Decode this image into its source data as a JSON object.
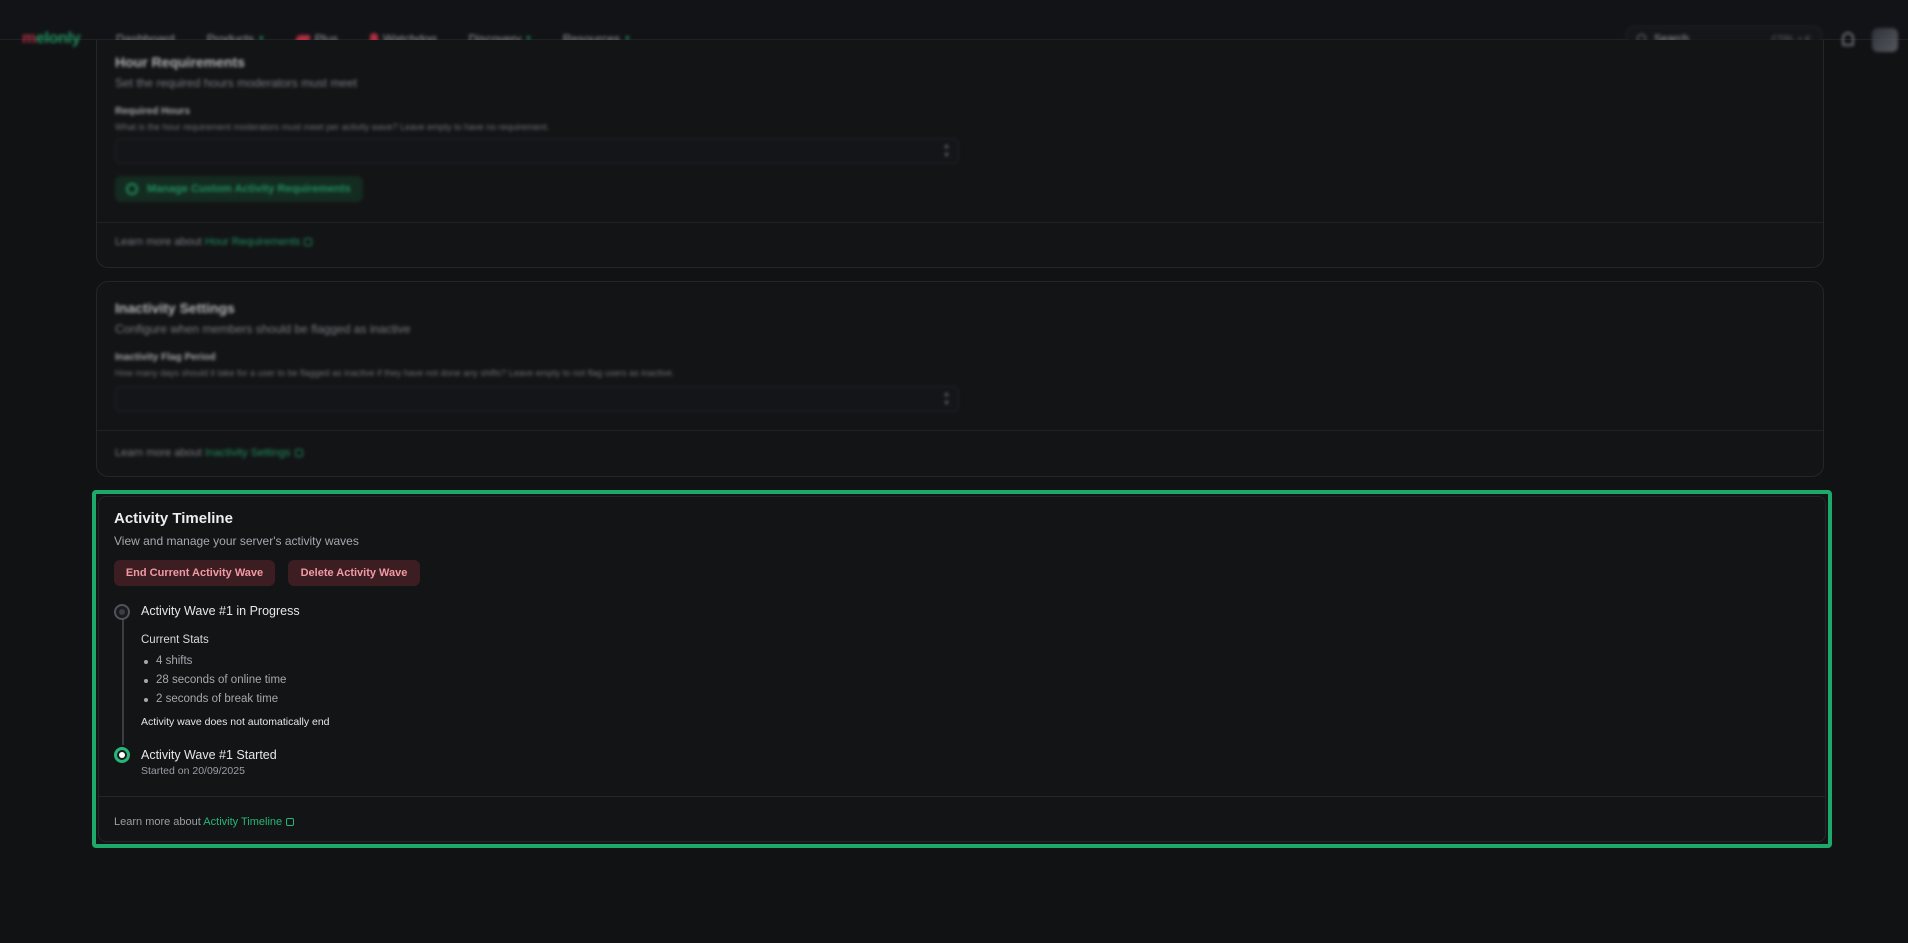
{
  "nav": {
    "logo_mark": "m",
    "logo_rest": "elonly",
    "items": [
      {
        "label": "Dashboard"
      },
      {
        "label": "Products",
        "chevron": "▾"
      },
      {
        "label": "Plus"
      },
      {
        "label": "Watchdog"
      },
      {
        "label": "Discovery",
        "chevron": "▾"
      },
      {
        "label": "Resources",
        "chevron": "▾"
      }
    ],
    "search_label": "Search",
    "search_shortcut": "CTRL + K"
  },
  "hour_requirements": {
    "title": "Hour Requirements",
    "subtitle": "Set the required hours moderators must meet",
    "field_label": "Required Hours",
    "field_help": "What is the hour requirement moderators must meet per activity wave? Leave empty to have no requirement.",
    "manage_button": "Manage Custom Activity Requirements",
    "learn_prefix": "Learn more about",
    "learn_link": "Hour Requirements"
  },
  "inactivity_settings": {
    "title": "Inactivity Settings",
    "subtitle": "Configure when members should be flagged as inactive",
    "field_label": "Inactivity Flag Period",
    "field_help": "How many days should it take for a user to be flagged as inactive if they have not done any shifts? Leave empty to not flag users as inactive.",
    "learn_prefix": "Learn more about",
    "learn_link": "Inactivity Settings"
  },
  "activity_timeline": {
    "title": "Activity Timeline",
    "subtitle": "View and manage your server's activity waves",
    "end_button": "End Current Activity Wave",
    "delete_button": "Delete Activity Wave",
    "events": [
      {
        "title": "Activity Wave #1 in Progress",
        "stats_heading": "Current Stats",
        "stats": [
          "4 shifts",
          "28 seconds of online time",
          "2 seconds of break time"
        ],
        "note": "Activity wave does not automatically end"
      },
      {
        "title": "Activity Wave #1 Started",
        "detail": "Started on 20/09/2025"
      }
    ],
    "learn_prefix": "Learn more about",
    "learn_link": "Activity Timeline"
  },
  "colors": {
    "accent_green": "#25b777",
    "highlight_border": "#1ea86a",
    "danger_bg": "#3b1d22",
    "danger_text": "#f19aa5",
    "background": "#111214"
  }
}
